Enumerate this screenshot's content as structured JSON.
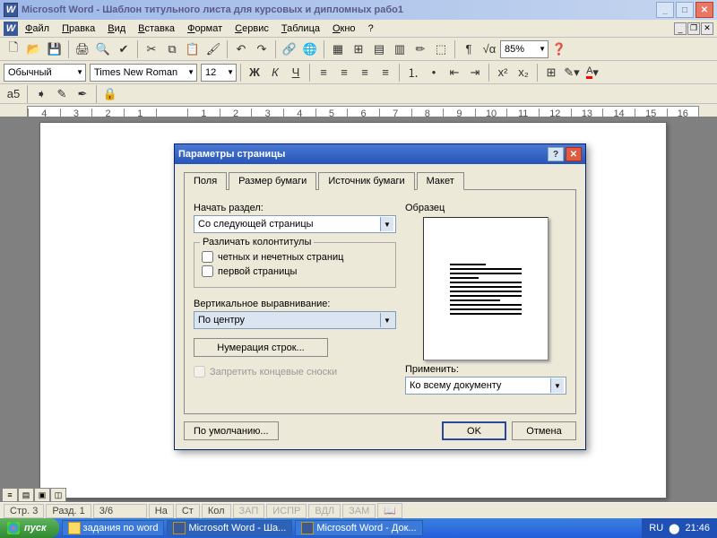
{
  "titlebar": {
    "app": "Microsoft Word",
    "doc": "Шаблон титульного листа для курсовых и дипломных рабо1"
  },
  "menu": {
    "file": "Файл",
    "edit": "Правка",
    "view": "Вид",
    "insert": "Вставка",
    "format": "Формат",
    "tools": "Сервис",
    "table": "Таблица",
    "window": "Окно",
    "help": "?"
  },
  "format_toolbar": {
    "style": "Обычный",
    "font": "Times New Roman",
    "size": "12",
    "zoom": "85%"
  },
  "dialog": {
    "title": "Параметры страницы",
    "tabs": {
      "fields": "Поля",
      "paper_size": "Размер бумаги",
      "paper_source": "Источник бумаги",
      "layout": "Макет"
    },
    "section_start_label": "Начать раздел:",
    "section_start_value": "Со следующей страницы",
    "headers_group": "Различать колонтитулы",
    "chk_oddeven": "четных и нечетных страниц",
    "chk_firstpage": "первой страницы",
    "valign_label": "Вертикальное выравнивание:",
    "valign_value": "По центру",
    "line_numbers_btn": "Нумерация строк...",
    "suppress_endnotes": "Запретить концевые сноски",
    "preview_label": "Образец",
    "apply_label": "Применить:",
    "apply_value": "Ко всему документу",
    "default_btn": "По умолчанию...",
    "ok": "OK",
    "cancel": "Отмена"
  },
  "statusbar": {
    "page": "Стр. 3",
    "section": "Разд. 1",
    "pages": "3/6",
    "at": "На",
    "line": "Ст",
    "col": "Кол",
    "rec": "ЗАП",
    "trk": "ИСПР",
    "ext": "ВДЛ",
    "ovr": "ЗАМ"
  },
  "taskbar": {
    "start": "пуск",
    "task1": "задания по word",
    "task2": "Microsoft Word - Ша...",
    "task3": "Microsoft Word - Док...",
    "lang": "RU",
    "time": "21:46"
  },
  "ruler_marks": [
    "4",
    "3",
    "2",
    "1",
    "",
    "1",
    "2",
    "3",
    "4",
    "5",
    "6",
    "7",
    "8",
    "9",
    "10",
    "11",
    "12",
    "13",
    "14",
    "15",
    "16"
  ]
}
